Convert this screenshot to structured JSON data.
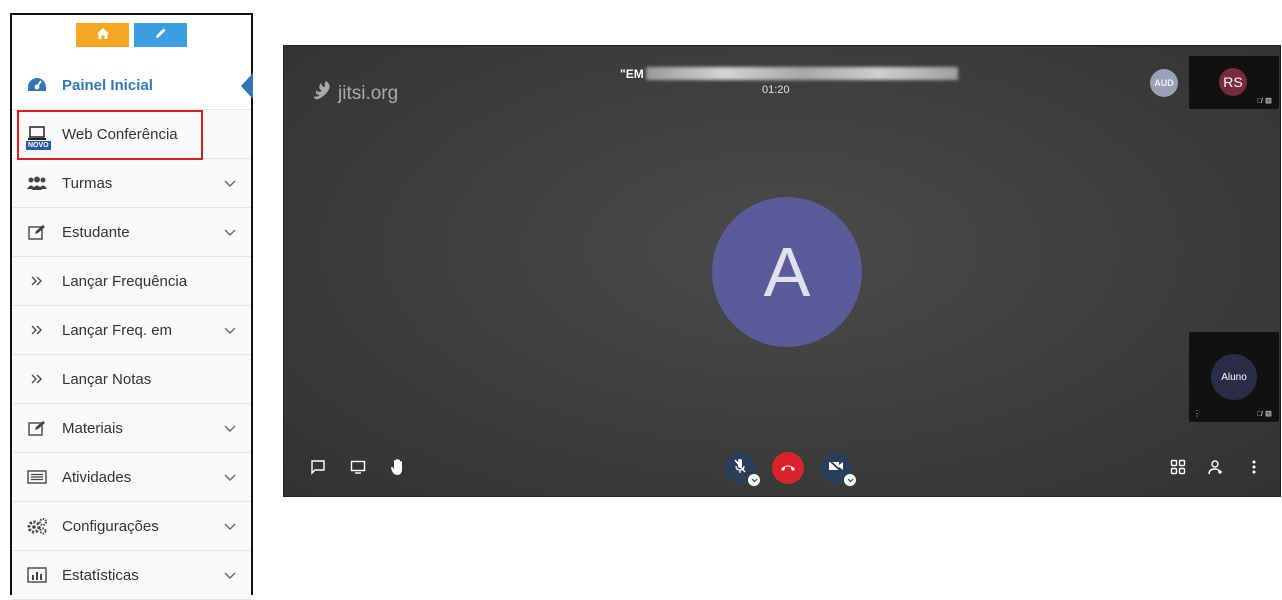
{
  "sidebar": {
    "top_buttons": [
      {
        "name": "home",
        "icon": "home-icon",
        "color": "#f5a623"
      },
      {
        "name": "edit",
        "icon": "pencil-icon",
        "color": "#3a9ee0"
      }
    ],
    "items": [
      {
        "label": "Painel Inicial",
        "icon": "dashboard-icon",
        "active": true,
        "has_chevron": false
      },
      {
        "label": "Web Conferência",
        "icon": "laptop-icon",
        "badge": "NOVO",
        "has_chevron": false
      },
      {
        "label": "Turmas",
        "icon": "users-icon",
        "has_chevron": true
      },
      {
        "label": "Estudante",
        "icon": "edit-square-icon",
        "has_chevron": true
      },
      {
        "label": "Lançar Frequência",
        "icon": "double-chevron-icon",
        "has_chevron": false
      },
      {
        "label": "Lançar Freq. em",
        "icon": "double-chevron-icon",
        "has_chevron": true
      },
      {
        "label": "Lançar Notas",
        "icon": "double-chevron-icon",
        "has_chevron": false
      },
      {
        "label": "Materiais",
        "icon": "edit-square-icon",
        "has_chevron": true
      },
      {
        "label": "Atividades",
        "icon": "list-icon",
        "has_chevron": true
      },
      {
        "label": "Configurações",
        "icon": "gears-icon",
        "has_chevron": true
      },
      {
        "label": "Estatísticas",
        "icon": "bar-chart-icon",
        "has_chevron": true
      }
    ],
    "highlight_color": "#e01d1d",
    "active_color": "#2e78b8"
  },
  "meeting": {
    "logo_text": "jitsi.org",
    "conference_name_prefix": "\"EM",
    "timer": "01:20",
    "main_avatar_letter": "A",
    "main_avatar_color": "#5a5c9a",
    "aud_label": "AUD",
    "participants": [
      {
        "initials": "RS",
        "color": "#7a2a3d"
      },
      {
        "initials": "Aluno",
        "color": "#2a2d45"
      }
    ],
    "toolbar": {
      "left": [
        "chat-icon",
        "screenshare-icon",
        "raise-hand-icon"
      ],
      "center": [
        "mic-muted-icon",
        "hangup-icon",
        "camera-off-icon"
      ],
      "right": [
        "tile-view-icon",
        "invite-icon",
        "more-icon"
      ]
    }
  }
}
